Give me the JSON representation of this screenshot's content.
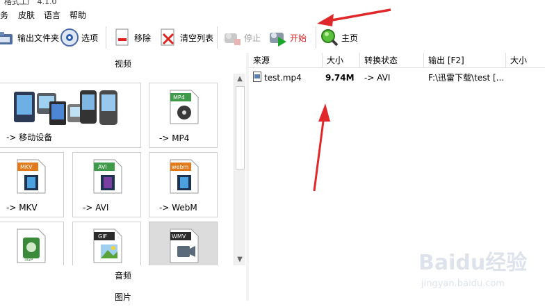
{
  "window": {
    "title_fragment": "格式工厂 4.1.0"
  },
  "menu": {
    "items": [
      "务",
      "皮肤",
      "语言",
      "帮助"
    ]
  },
  "toolbar": {
    "output_folder": "输出文件夹",
    "options": "选项",
    "remove": "移除",
    "clear_list": "清空列表",
    "stop": "停止",
    "start": "开始",
    "home": "主页"
  },
  "sections": {
    "video": "视频",
    "audio": "音频",
    "image": "图片"
  },
  "tiles": [
    {
      "label": "-> 移动设备",
      "icon": "mobile-devices-icon"
    },
    {
      "label": "-> MP4",
      "icon": "mp4-file-icon",
      "badge": "MP4"
    },
    {
      "label": "-> MKV",
      "icon": "mkv-file-icon",
      "badge": "MKV"
    },
    {
      "label": "-> AVI",
      "icon": "avi-file-icon",
      "badge": "AVI"
    },
    {
      "label": "-> WebM",
      "icon": "webm-file-icon",
      "badge": "webm"
    },
    {
      "label": "",
      "icon": "3gp-file-icon",
      "badge": "3GP"
    },
    {
      "label": "",
      "icon": "gif-file-icon",
      "badge": "GIF"
    },
    {
      "label": "",
      "icon": "wmv-file-icon",
      "badge": "WMV"
    }
  ],
  "file_list": {
    "columns": [
      "来源",
      "大小",
      "转换状态",
      "输出 [F2]",
      "大小"
    ],
    "rows": [
      {
        "source": "test.mp4",
        "size": "9.74M",
        "status": "-> AVI",
        "output": "F:\\迅雷下载\\test [...",
        "out_size": ""
      }
    ]
  },
  "watermark": {
    "brand": "Baidu经验",
    "url": "jingyan.baidu.com"
  },
  "colors": {
    "accent_red": "#e0282b",
    "badge_green": "#3f9a4a",
    "badge_orange": "#e07a1a",
    "badge_dark": "#2b2b2b"
  }
}
